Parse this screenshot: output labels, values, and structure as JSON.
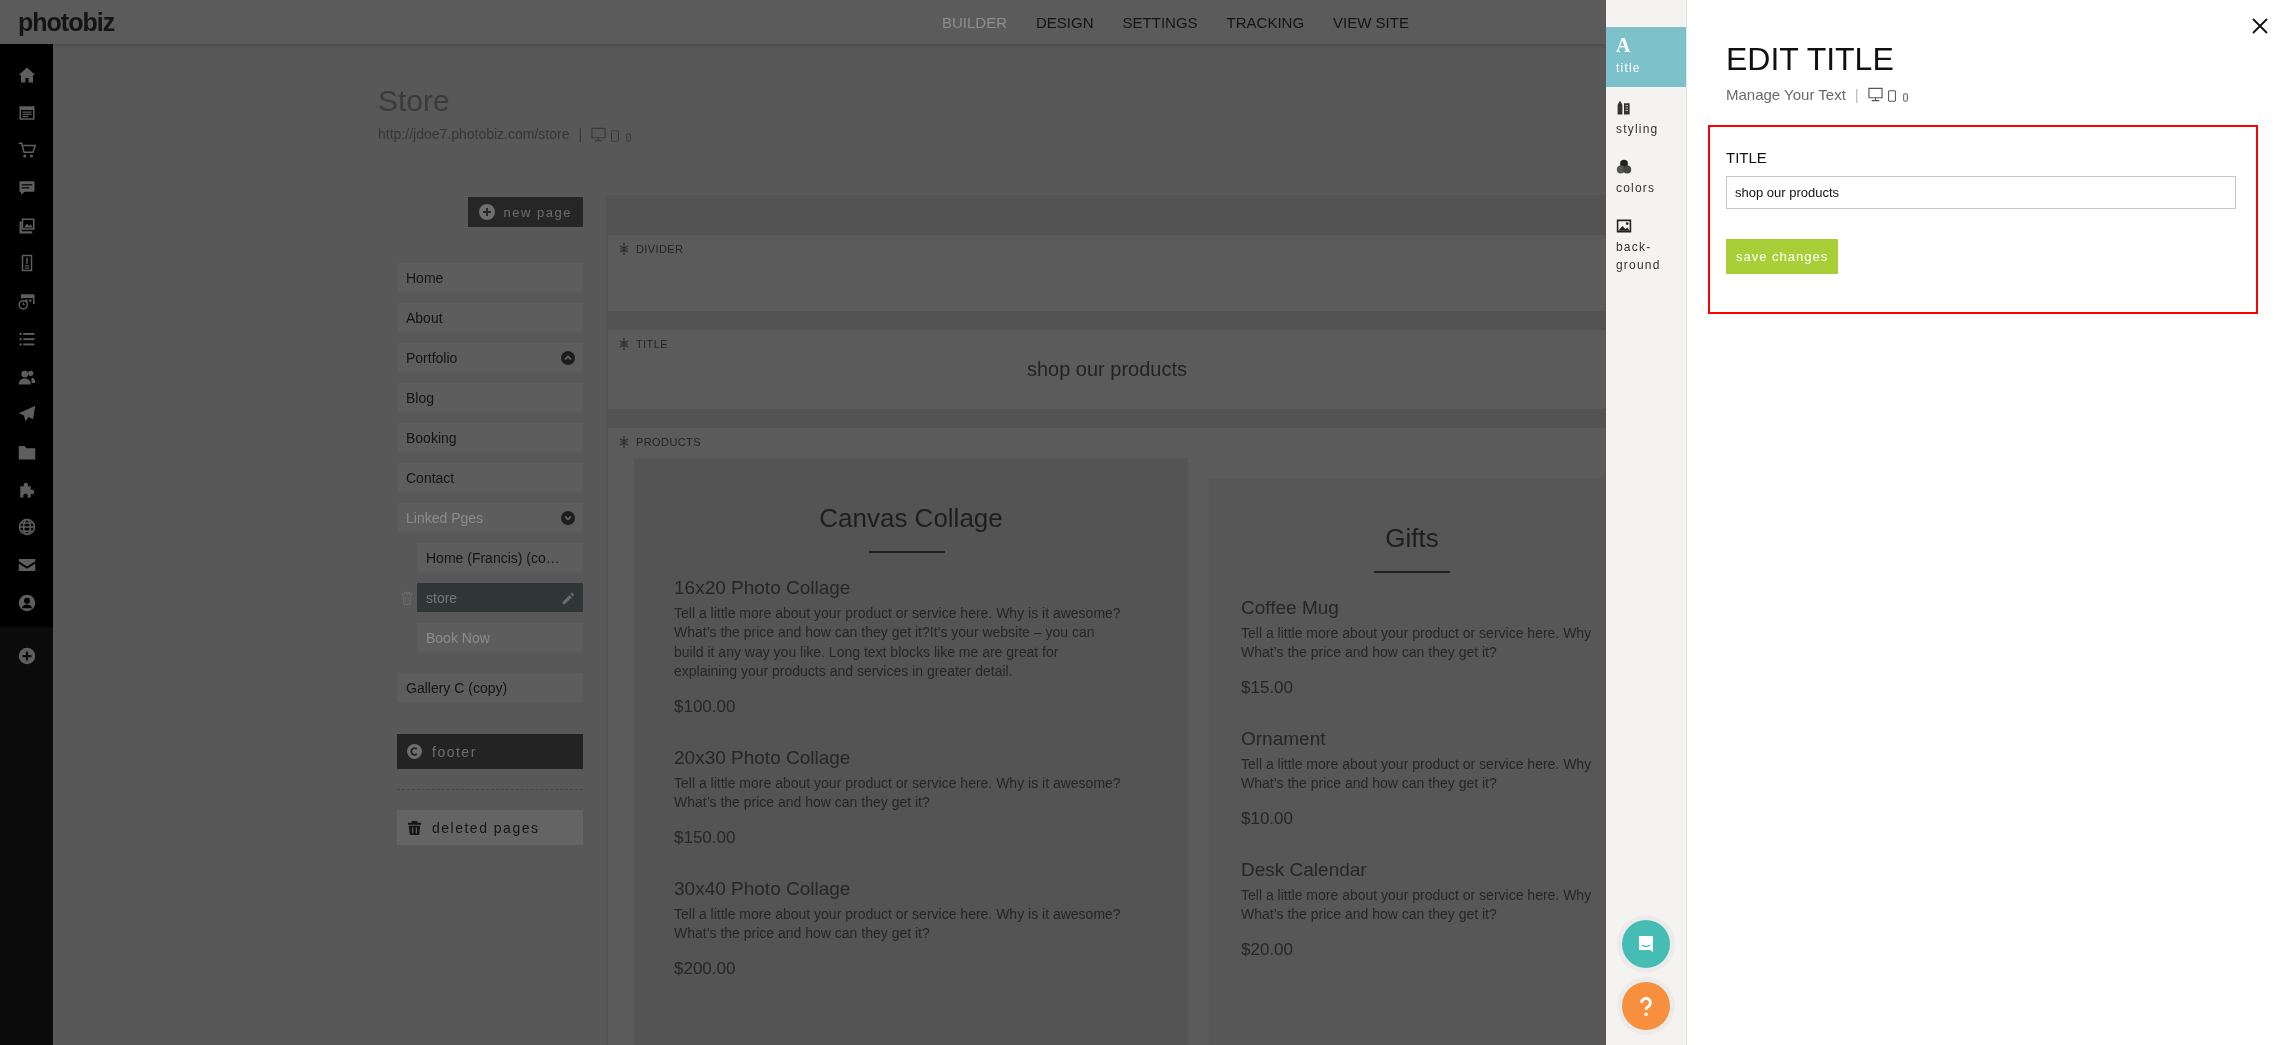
{
  "header": {
    "logo": "photobiz",
    "nav": [
      {
        "label": "BUILDER",
        "selected": true
      },
      {
        "label": "DESIGN",
        "selected": false
      },
      {
        "label": "SETTINGS",
        "selected": false
      },
      {
        "label": "TRACKING",
        "selected": false
      },
      {
        "label": "VIEW SITE",
        "selected": false
      }
    ]
  },
  "page": {
    "title": "Store",
    "url": "http://jdoe7.photobiz.com/store",
    "separator": "|"
  },
  "pages": {
    "new_page": "new page",
    "items": [
      {
        "label": "Home",
        "selected": false,
        "disabled": false
      },
      {
        "label": "About",
        "selected": false,
        "disabled": false
      },
      {
        "label": "Portfolio",
        "selected": false,
        "disabled": false,
        "expanded": false
      },
      {
        "label": "Blog",
        "selected": false,
        "disabled": false
      },
      {
        "label": "Booking",
        "selected": false,
        "disabled": false
      },
      {
        "label": "Contact",
        "selected": false,
        "disabled": false
      },
      {
        "label": "Linked Pges",
        "selected": false,
        "disabled": true,
        "expanded": true,
        "children": [
          {
            "label": "Home (Francis) (co…",
            "selected": false,
            "disabled": false
          },
          {
            "label": "store",
            "selected": true,
            "disabled": false
          },
          {
            "label": "Book Now",
            "selected": false,
            "disabled": true
          }
        ]
      },
      {
        "label": "Gallery C (copy)",
        "selected": false,
        "disabled": false
      }
    ],
    "footer": "footer",
    "deleted": "deleted pages"
  },
  "sections": [
    {
      "kind": "divider",
      "label": "DIVIDER"
    },
    {
      "kind": "title",
      "label": "TITLE",
      "text": "shop our products"
    },
    {
      "kind": "products",
      "label": "PRODUCTS",
      "columns": [
        {
          "heading": "Canvas Collage",
          "products": [
            {
              "name": "16x20 Photo Collage",
              "lines": [
                "Tell a little more about your product or service here. Why is it awesome?",
                "What’s the price and how can they get it?It’s your website – you can",
                "build it any way you like. Long text blocks like me are great for",
                "explaining your products and services in greater detail."
              ],
              "price": "$100.00"
            },
            {
              "name": "20x30 Photo Collage",
              "lines": [
                "Tell a little more about your product or service here. Why is it awesome?",
                "What’s the price and how can they get it?"
              ],
              "price": "$150.00"
            },
            {
              "name": "30x40 Photo Collage",
              "lines": [
                "Tell a little more about your product or service here. Why is it awesome?",
                "What’s the price and how can they get it?"
              ],
              "price": "$200.00"
            }
          ]
        },
        {
          "heading": "Gifts",
          "products": [
            {
              "name": "Coffee Mug",
              "lines": [
                "Tell a little more about your product or service here. Why",
                "What’s the price and how can they get it?"
              ],
              "price": "$15.00"
            },
            {
              "name": "Ornament",
              "lines": [
                "Tell a little more about your product or service here. Why",
                "What’s the price and how can they get it?"
              ],
              "price": "$10.00"
            },
            {
              "name": "Desk Calendar",
              "lines": [
                "Tell a little more about your product or service here. Why",
                "What’s the price and how can they get it?"
              ],
              "price": "$20.00"
            }
          ]
        }
      ]
    }
  ],
  "editor": {
    "tabs": [
      {
        "kind": "title",
        "glyph": "A",
        "label": "title",
        "selected": true
      },
      {
        "kind": "styling",
        "label": "styling",
        "selected": false
      },
      {
        "kind": "colors",
        "label": "colors",
        "selected": false
      },
      {
        "kind": "background",
        "label": "back-ground",
        "selected": false
      }
    ],
    "title": "EDIT TITLE",
    "subtitle": "Manage Your Text",
    "separator": "|",
    "field_label": "TITLE",
    "field_value": "shop our products",
    "save": "save changes"
  }
}
